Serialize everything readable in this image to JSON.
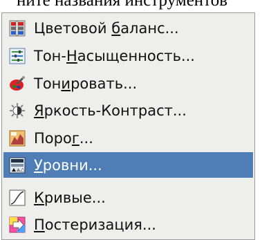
{
  "caption": "ните названия инструментов",
  "menu": {
    "items": [
      {
        "pre": "Цветовой ",
        "mn": "б",
        "post": "аланс...",
        "icon": "color-balance-icon"
      },
      {
        "pre": "Тон-",
        "mn": "Н",
        "post": "асыщенность...",
        "icon": "hue-saturation-icon"
      },
      {
        "pre": "Тон",
        "mn": "и",
        "post": "ровать...",
        "icon": "colorize-icon"
      },
      {
        "pre": "",
        "mn": "Я",
        "post": "ркость-Контраст...",
        "icon": "brightness-contrast-icon"
      },
      {
        "pre": "Поро",
        "mn": "г",
        "post": "...",
        "icon": "threshold-icon"
      },
      {
        "pre": "",
        "mn": "У",
        "post": "ровни...",
        "icon": "levels-icon"
      },
      {
        "pre": "",
        "mn": "К",
        "post": "ривые...",
        "icon": "curves-icon"
      },
      {
        "pre": "",
        "mn": "П",
        "post": "остеризация...",
        "icon": "posterize-icon"
      }
    ],
    "selected_index": 5
  }
}
